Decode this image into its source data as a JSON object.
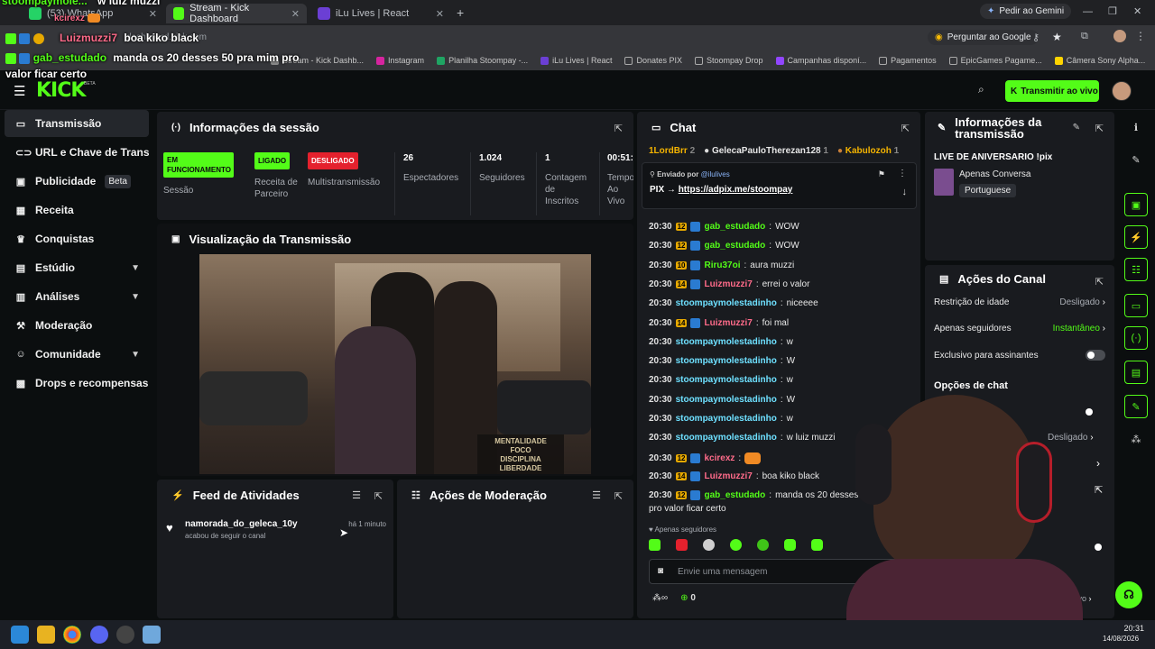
{
  "browser": {
    "tabs": [
      {
        "label": "(53) WhatsApp"
      },
      {
        "label": "Stream - Kick Dashboard",
        "active": true
      },
      {
        "label": "iLu Lives | React"
      }
    ],
    "gemini_label": "Pedir ao Gemini",
    "ask_google_label": "Perguntar ao Google",
    "address_fragment": "dashboard.kick.com",
    "bookmarks": [
      "Instagram",
      "Planilha Stoompay -...",
      "iLu Lives | React",
      "Donates PIX",
      "Stoompay Drop",
      "Campanhas disponí...",
      "Pagamentos",
      "EpicGames Pagame...",
      "Câmera Sony Alpha..."
    ],
    "bookmark_partial": "Stream - Kick Dashb..."
  },
  "overlay_chat": [
    {
      "user": "stoompaymole...",
      "message": "w luiz muzzi"
    },
    {
      "user": "kcirexz",
      "message": ""
    },
    {
      "user": "Luizmuzzi7",
      "message": "boa kiko black"
    },
    {
      "user": "gab_estudado",
      "message": "manda os 20 desses 50 pra mim pro valor ficar certo"
    }
  ],
  "header": {
    "logo": "KICK",
    "logo_tag": "BETA",
    "go_live_label": "Transmitir ao vivo"
  },
  "sidebar": {
    "items": [
      {
        "label": "Transmissão",
        "icon": "broadcast-icon",
        "active": true
      },
      {
        "label": "URL e Chave de Transmissão",
        "icon": "link-icon"
      },
      {
        "label": "Publicidade",
        "icon": "ad-icon",
        "badge": "Beta"
      },
      {
        "label": "Receita",
        "icon": "revenue-icon"
      },
      {
        "label": "Conquistas",
        "icon": "trophy-icon"
      },
      {
        "label": "Estúdio",
        "icon": "studio-icon",
        "expandable": true
      },
      {
        "label": "Análises",
        "icon": "analytics-icon",
        "expandable": true
      },
      {
        "label": "Moderação",
        "icon": "hammer-icon"
      },
      {
        "label": "Comunidade",
        "icon": "community-icon",
        "expandable": true
      },
      {
        "label": "Drops e recompensas",
        "icon": "gift-icon"
      }
    ]
  },
  "session": {
    "title": "Informações da sessão",
    "stats": [
      {
        "badge": "EM FUNCIONAMENTO",
        "label": "Sessão",
        "color": "#53fc18"
      },
      {
        "badge": "LIGADO",
        "label": "Receita de Parceiro",
        "color": "#53fc18"
      },
      {
        "badge": "DESLIGADO",
        "label": "Multistransmissão",
        "color": "#e4212d"
      },
      {
        "value": "26",
        "label": "Espectadores"
      },
      {
        "value": "1.024",
        "label": "Seguidores"
      },
      {
        "value": "1",
        "label": "Contagem de Inscritos"
      },
      {
        "value": "00:51:",
        "label": "Tempo Ao Vivo"
      }
    ]
  },
  "preview": {
    "title": "Visualização da Transmissão",
    "poster_lines": [
      "MENTALIDADE",
      "FOCO",
      "DISCIPLINA",
      "LIBERDADE"
    ]
  },
  "activity": {
    "title": "Feed de Atividades",
    "items": [
      {
        "user": "namorada_do_geleca_10y",
        "action": "acabou de seguir o canal",
        "time": "há 1 minuto"
      }
    ]
  },
  "moderation": {
    "title": "Ações de Moderação"
  },
  "chat": {
    "title": "Chat",
    "top_gifters": [
      {
        "name": "1LordBrr",
        "count": "2"
      },
      {
        "name": "GelecaPauloTherezan128",
        "count": "1"
      },
      {
        "name": "Kabulozoh",
        "count": "1"
      }
    ],
    "pinned_by_label": "Enviado por",
    "pinned_by": "@ilulives",
    "pinned_prefix": "PIX →",
    "pinned_link": "https://adpix.me/stoompay",
    "messages": [
      {
        "time": "20:30",
        "level": "12",
        "user": "gab_estudado",
        "text": "WOW",
        "style": "green"
      },
      {
        "time": "20:30",
        "level": "12",
        "user": "gab_estudado",
        "text": "WOW",
        "style": "green"
      },
      {
        "time": "20:30",
        "level": "10",
        "user": "Riru37oi",
        "text": "aura muzzi",
        "style": "green"
      },
      {
        "time": "20:30",
        "level": "14",
        "user": "Luizmuzzi7",
        "text": "errei o valor",
        "style": "red"
      },
      {
        "time": "20:30",
        "level": "",
        "user": "stoompaymolestadinho",
        "text": "niceeee",
        "style": "cyan"
      },
      {
        "time": "20:30",
        "level": "14",
        "user": "Luizmuzzi7",
        "text": "foi mal",
        "style": "red"
      },
      {
        "time": "20:30",
        "level": "",
        "user": "stoompaymolestadinho",
        "text": "w",
        "style": "cyan"
      },
      {
        "time": "20:30",
        "level": "",
        "user": "stoompaymolestadinho",
        "text": "W",
        "style": "cyan"
      },
      {
        "time": "20:30",
        "level": "",
        "user": "stoompaymolestadinho",
        "text": "w",
        "style": "cyan"
      },
      {
        "time": "20:30",
        "level": "",
        "user": "stoompaymolestadinho",
        "text": "W",
        "style": "cyan"
      },
      {
        "time": "20:30",
        "level": "",
        "user": "stoompaymolestadinho",
        "text": "w",
        "style": "cyan"
      },
      {
        "time": "20:30",
        "level": "",
        "user": "stoompaymolestadinho",
        "text": "w luiz muzzi",
        "style": "cyan"
      },
      {
        "time": "20:30",
        "level": "12",
        "user": "kcirexz",
        "text": "",
        "style": "red"
      },
      {
        "time": "20:30",
        "level": "14",
        "user": "Luizmuzzi7",
        "text": "boa kiko black",
        "style": "red"
      },
      {
        "time": "20:30",
        "level": "12",
        "user": "gab_estudado",
        "text": "manda os 20 desses 50",
        "style": "green"
      }
    ],
    "wrap_line": "pro valor ficar certo",
    "followers_only": "Apenas seguidores",
    "input_placeholder": "Envie uma mensagem",
    "points": "0"
  },
  "stream_info": {
    "title": "Informações da transmissão",
    "stream_title": "LIVE DE ANIVERSARIO !pix",
    "category": "Apenas Conversa",
    "language": "Portuguese"
  },
  "channel_actions": {
    "title": "Ações do Canal",
    "rows": [
      {
        "label": "Restrição de idade",
        "value": "Desligado"
      },
      {
        "label": "Apenas seguidores",
        "value": "Instantâneo"
      },
      {
        "label": "Exclusivo para assinantes",
        "toggle": false
      }
    ],
    "chat_options_title": "Opções de chat",
    "partial_value": "Desligado",
    "partial_value2": "ativo"
  },
  "taskbar": {
    "time": "20:31",
    "date": "14/08/2026"
  }
}
